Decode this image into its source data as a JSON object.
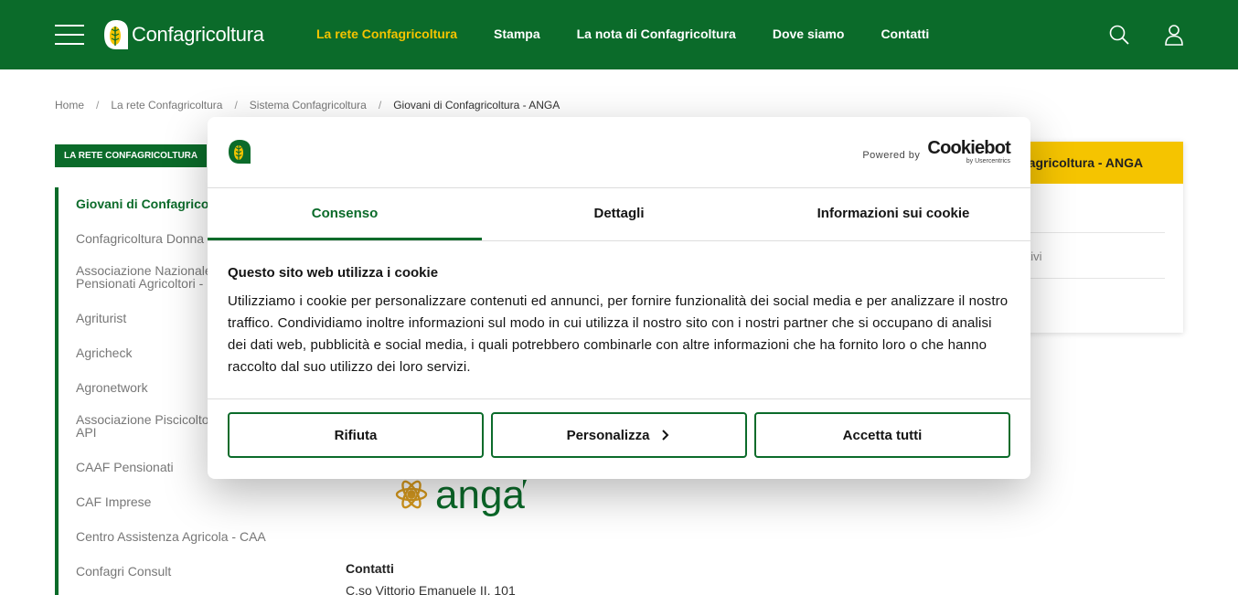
{
  "header": {
    "logo_text": "Confagricoltura",
    "nav": [
      {
        "label": "La rete Confagricoltura",
        "active": true
      },
      {
        "label": "Stampa",
        "active": false
      },
      {
        "label": "La nota di Confagricoltura",
        "active": false
      },
      {
        "label": "Dove siamo",
        "active": false
      },
      {
        "label": "Contatti",
        "active": false
      }
    ],
    "icons": [
      "menu-icon",
      "search-icon",
      "user-icon"
    ]
  },
  "breadcrumb": [
    "Home",
    "La rete Confagricoltura",
    "Sistema Confagricoltura",
    "Giovani di Confagricoltura - ANGA"
  ],
  "sidebar": {
    "section_tag": "LA RETE CONFAGRICOLTURA",
    "items": [
      {
        "label": "Giovani di Confagricoltu",
        "active": true
      },
      {
        "label": "Confagricoltura Donna",
        "active": false
      },
      {
        "label": "Associazione Nazionale",
        "active": false
      },
      {
        "label": "Pensionati Agricoltori -",
        "active": false
      },
      {
        "label": "Agriturist",
        "active": false
      },
      {
        "label": "Agricheck",
        "active": false
      },
      {
        "label": "Agronetwork",
        "active": false
      },
      {
        "label": "Associazione Piscicolto",
        "active": false
      },
      {
        "label": "API",
        "active": false
      },
      {
        "label": "CAAF Pensionati",
        "active": false
      },
      {
        "label": "CAF Imprese",
        "active": false
      },
      {
        "label": "Centro Assistenza Agricola - CAA",
        "active": false
      },
      {
        "label": "Confagri Consult",
        "active": false
      }
    ]
  },
  "right_card": {
    "title": "fagricoltura - ANGA",
    "link": "ttivi"
  },
  "main": {
    "anga_text": "anga",
    "contacts_title": "Contatti",
    "contacts_address": "C.so Vittorio Emanuele II, 101"
  },
  "cookie": {
    "powered_by": "Powered by",
    "brand": "Cookiebot",
    "brand_sub": "by Usercentrics",
    "tabs": [
      "Consenso",
      "Dettagli",
      "Informazioni sui cookie"
    ],
    "active_tab": "Consenso",
    "title": "Questo sito web utilizza i cookie",
    "body": "Utilizziamo i cookie per personalizzare contenuti ed annunci, per fornire funzionalità dei social media e per analizzare il nostro traffico. Condividiamo inoltre informazioni sul modo in cui utilizza il nostro sito con i nostri partner che si occupano di analisi dei dati web, pubblicità e social media, i quali potrebbero combinarle con altre informazioni che ha fornito loro o che hanno raccolto dal suo utilizzo dei loro servizi.",
    "buttons": {
      "reject": "Rifiuta",
      "customize": "Personalizza",
      "accept_all": "Accetta tutti"
    }
  },
  "colors": {
    "brand_green": "#0b6b2a",
    "accent_yellow": "#f5c400"
  }
}
